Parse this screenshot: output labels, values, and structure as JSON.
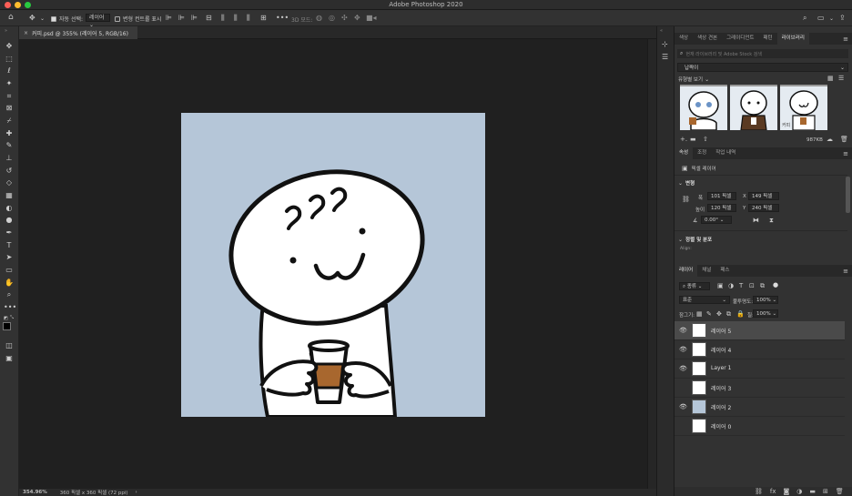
{
  "app": {
    "title": "Adobe Photoshop 2020"
  },
  "options_bar": {
    "auto_select_label": "자동 선택:",
    "auto_select_target": "레이어",
    "show_transform_label": "변형 컨트롤 표시",
    "mode_3d_label": "3D 모드:"
  },
  "document": {
    "tab_title": "커피.psd @ 355% (레이어 5, RGB/16)",
    "zoom": "354.96%",
    "dimensions": "360 픽셀 x 360 픽셀 (72 ppi)",
    "canvas_bg": "#b5c6d8",
    "cup_color": "#a8672e"
  },
  "panels_top": {
    "tabs": [
      "색상",
      "색상 견본",
      "그레이디언트",
      "패턴",
      "라이브러리"
    ],
    "active_tab": 4,
    "search_placeholder": "현재 라이브러리 및 Adobe Stock 검색",
    "library_name": "납짝이",
    "view_by": "유형별 보기",
    "thumb_caption": "커피",
    "size": "987KB"
  },
  "properties": {
    "tabs": [
      "속성",
      "조정",
      "작업 내역"
    ],
    "active_tab": 0,
    "layer_type": "픽셀 레이어",
    "transform_label": "변형",
    "w_label": "폭",
    "w_value": "101 픽셀",
    "h_label": "높이",
    "h_value": "120 픽셀",
    "x_label": "X",
    "x_value": "149 픽셀",
    "y_label": "Y",
    "y_value": "240 픽셀",
    "angle_value": "0.00°",
    "align_label": "정렬 및 분포",
    "align_sub": "Align:"
  },
  "layers_panel": {
    "tabs": [
      "레이어",
      "채널",
      "패스"
    ],
    "active_tab": 0,
    "filter_label": "종류",
    "blend_mode": "표준",
    "opacity_label": "불투명도:",
    "opacity_value": "100%",
    "lock_label": "잠그기:",
    "fill_label": "칠:",
    "fill_value": "100%",
    "layers": [
      {
        "name": "레이어 5",
        "visible": true,
        "selected": true,
        "thumb": "#ffffff"
      },
      {
        "name": "레이어 4",
        "visible": true,
        "selected": false,
        "thumb": "#ffffff"
      },
      {
        "name": "Layer 1",
        "visible": true,
        "selected": false,
        "thumb": "#ffffff"
      },
      {
        "name": "레이어 3",
        "visible": false,
        "selected": false,
        "thumb": "#ffffff"
      },
      {
        "name": "레이어 2",
        "visible": true,
        "selected": false,
        "thumb": "#b5c6d8"
      },
      {
        "name": "레이어 0",
        "visible": false,
        "selected": false,
        "thumb": "#ffffff"
      }
    ]
  }
}
